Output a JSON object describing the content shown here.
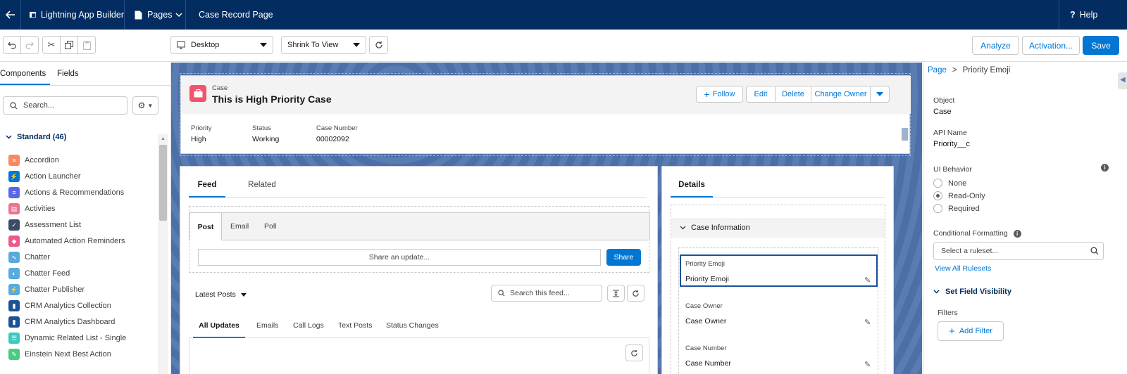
{
  "topbar": {
    "app_name": "Lightning App Builder",
    "pages_label": "Pages",
    "page_name": "Case Record Page",
    "help_label": "Help"
  },
  "toolbar": {
    "device": "Desktop",
    "view_mode": "Shrink To View",
    "analyze_label": "Analyze",
    "activation_label": "Activation...",
    "save_label": "Save"
  },
  "left_panel": {
    "tabs": [
      "Components",
      "Fields"
    ],
    "search_placeholder": "Search...",
    "section_title": "Standard (46)",
    "components": [
      {
        "label": "Accordion",
        "color": "#f88962",
        "glyph": "≡"
      },
      {
        "label": "Action Launcher",
        "color": "#0176d3",
        "glyph": "⚡"
      },
      {
        "label": "Actions & Recommendations",
        "color": "#5867e8",
        "glyph": "≡"
      },
      {
        "label": "Activities",
        "color": "#ea7491",
        "glyph": "▤"
      },
      {
        "label": "Assessment List",
        "color": "#3b4d66",
        "glyph": "✓"
      },
      {
        "label": "Automated Action Reminders",
        "color": "#ea5a8c",
        "glyph": "◆"
      },
      {
        "label": "Chatter",
        "color": "#56aadf",
        "glyph": "∿"
      },
      {
        "label": "Chatter Feed",
        "color": "#56aadf",
        "glyph": "◐"
      },
      {
        "label": "Chatter Publisher",
        "color": "#56aadf",
        "glyph": "⚡"
      },
      {
        "label": "CRM Analytics Collection",
        "color": "#1b5297",
        "glyph": "▮"
      },
      {
        "label": "CRM Analytics Dashboard",
        "color": "#1b5297",
        "glyph": "▮"
      },
      {
        "label": "Dynamic Related List - Single",
        "color": "#3bc8c0",
        "glyph": "☰"
      },
      {
        "label": "Einstein Next Best Action",
        "color": "#4bca81",
        "glyph": "✎"
      }
    ]
  },
  "canvas": {
    "highlights": {
      "object_label": "Case",
      "record_title": "This is High Priority Case",
      "actions": [
        "Follow",
        "Edit",
        "Delete",
        "Change Owner"
      ],
      "fields": [
        {
          "label": "Priority",
          "value": "High"
        },
        {
          "label": "Status",
          "value": "Working"
        },
        {
          "label": "Case Number",
          "value": "00002092"
        }
      ]
    },
    "feed": {
      "tabs": [
        "Feed",
        "Related"
      ],
      "publisher_tabs": [
        "Post",
        "Email",
        "Poll"
      ],
      "share_placeholder": "Share an update...",
      "share_label": "Share",
      "sort_label": "Latest Posts",
      "search_placeholder": "Search this feed...",
      "filter_tabs": [
        "All Updates",
        "Emails",
        "Call Logs",
        "Text Posts",
        "Status Changes"
      ]
    },
    "details": {
      "tab": "Details",
      "section": "Case Information",
      "fields": [
        {
          "label": "Priority Emoji",
          "value": "Priority Emoji"
        },
        {
          "label": "Case Owner",
          "value": "Case Owner"
        },
        {
          "label": "Case Number",
          "value": "Case Number"
        }
      ]
    }
  },
  "right_panel": {
    "breadcrumb_root": "Page",
    "breadcrumb_sep": ">",
    "breadcrumb_current": "Priority Emoji",
    "object_label": "Object",
    "object_value": "Case",
    "api_name_label": "API Name",
    "api_name_value": "Priority__c",
    "ui_behavior_label": "UI Behavior",
    "ui_options": [
      "None",
      "Read-Only",
      "Required"
    ],
    "ui_selected": "Read-Only",
    "conditional_label": "Conditional Formatting",
    "ruleset_placeholder": "Select a ruleset...",
    "view_all_label": "View All Rulesets",
    "visibility_label": "Set Field Visibility",
    "filters_label": "Filters",
    "add_filter_label": "Add Filter"
  }
}
